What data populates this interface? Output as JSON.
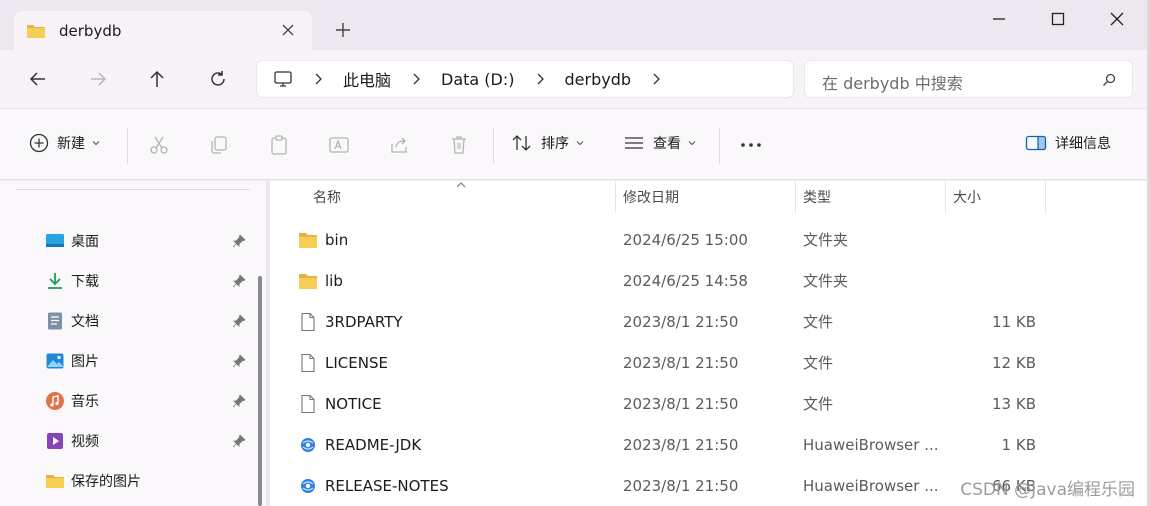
{
  "tab": {
    "title": "derbydb"
  },
  "address": {
    "items": [
      "此电脑",
      "Data (D:)",
      "derbydb"
    ]
  },
  "search": {
    "placeholder": "在 derbydb 中搜索"
  },
  "commands": {
    "new_label": "新建",
    "sort_label": "排序",
    "view_label": "查看",
    "details_label": "详细信息"
  },
  "sidebar": {
    "items": [
      {
        "label": "桌面",
        "icon": "desktop-icon",
        "pinned": true
      },
      {
        "label": "下载",
        "icon": "download-icon",
        "pinned": true
      },
      {
        "label": "文档",
        "icon": "document-icon",
        "pinned": true
      },
      {
        "label": "图片",
        "icon": "pictures-icon",
        "pinned": true
      },
      {
        "label": "音乐",
        "icon": "music-icon",
        "pinned": true
      },
      {
        "label": "视频",
        "icon": "video-icon",
        "pinned": true
      },
      {
        "label": "保存的图片",
        "icon": "folder-icon",
        "pinned": false
      }
    ]
  },
  "columns": {
    "name": "名称",
    "modified": "修改日期",
    "type": "类型",
    "size": "大小"
  },
  "files": [
    {
      "name": "bin",
      "date": "2024/6/25 15:00",
      "type": "文件夹",
      "size": "",
      "icon": "folder-icon"
    },
    {
      "name": "lib",
      "date": "2024/6/25 14:58",
      "type": "文件夹",
      "size": "",
      "icon": "folder-icon"
    },
    {
      "name": "3RDPARTY",
      "date": "2023/8/1 21:50",
      "type": "文件",
      "size": "11 KB",
      "icon": "file-icon"
    },
    {
      "name": "LICENSE",
      "date": "2023/8/1 21:50",
      "type": "文件",
      "size": "12 KB",
      "icon": "file-icon"
    },
    {
      "name": "NOTICE",
      "date": "2023/8/1 21:50",
      "type": "文件",
      "size": "13 KB",
      "icon": "file-icon"
    },
    {
      "name": "README-JDK",
      "date": "2023/8/1 21:50",
      "type": "HuaweiBrowser ...",
      "size": "1 KB",
      "icon": "browser-html-icon"
    },
    {
      "name": "RELEASE-NOTES",
      "date": "2023/8/1 21:50",
      "type": "HuaweiBrowser ...",
      "size": "66 KB",
      "icon": "browser-html-icon"
    }
  ],
  "watermark": "CSDN @Java编程乐园",
  "colors": {
    "folder": "#f2c94c",
    "accent": "#0067c0",
    "titlebar": "#ede7f0"
  }
}
